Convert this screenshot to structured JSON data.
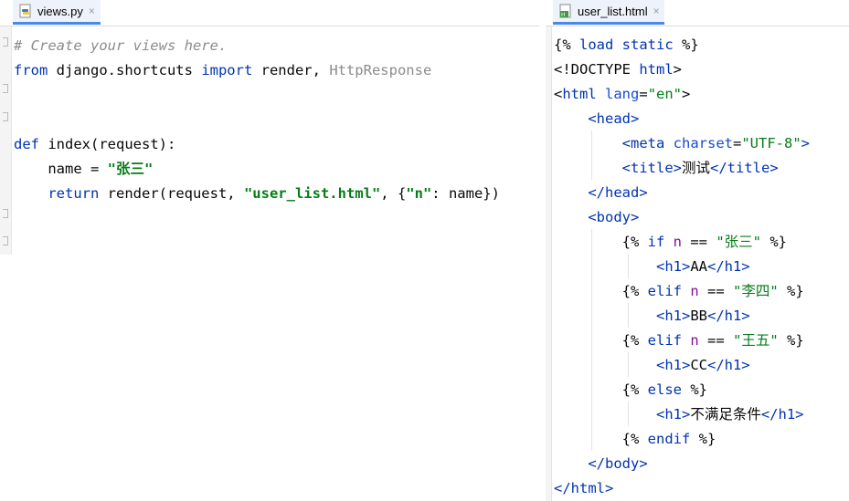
{
  "tabs": {
    "left": {
      "label": "views.py",
      "close": "×"
    },
    "right": {
      "label": "user_list.html",
      "close": "×"
    }
  },
  "icons": {
    "python_file": "python-file-icon",
    "html_file": "html-file-icon",
    "close": "close-icon"
  },
  "left_code": {
    "comment": "# Create your views here.",
    "from_kw": "from",
    "module": " django.shortcuts ",
    "import_kw": "import",
    "imported": " render, ",
    "unused_import": "HttpResponse",
    "def_kw": "def",
    "def_sig": " index(request):",
    "assign_name": "    name = ",
    "assign_value": "\"张三\"",
    "return_kw": "    return",
    "return_call": " render(request, ",
    "template_str": "\"user_list.html\"",
    "ctx_open": ", {",
    "ctx_key": "\"n\"",
    "ctx_rest": ": name})"
  },
  "right_code": {
    "line1_a": "{% ",
    "line1_kw": "load static",
    "line1_b": " %}",
    "line2_a": "<!DOCTYPE ",
    "line2_b": "html",
    "line2_c": ">",
    "line3_a": "<",
    "line3_tag": "html ",
    "line3_attr": "lang",
    "line3_eq": "=",
    "line3_val": "\"en\"",
    "line3_end": ">",
    "head_open": "    <head>",
    "meta_a": "        <",
    "meta_tag": "meta ",
    "meta_attr": "charset",
    "meta_eq": "=",
    "meta_val": "\"UTF-8\"",
    "meta_end": ">",
    "title_open": "        <title>",
    "title_text": "测试",
    "title_close": "</title>",
    "head_close": "    </head>",
    "body_open": "    <body>",
    "if_a": "        {% ",
    "if_kw": "if",
    "if_var": " n",
    "if_op": " == ",
    "if_val": "\"张三\"",
    "if_end": " %}",
    "h1_aa_open": "            <h1>",
    "h1_aa_text": "AA",
    "h1_aa_close": "</h1>",
    "elif1_kw": "elif",
    "elif1_val": "\"李四\"",
    "h1_bb_text": "BB",
    "elif2_val": "\"王五\"",
    "h1_cc_text": "CC",
    "else_kw": "else",
    "h1_else_text": "不满足条件",
    "endif_kw": "endif",
    "body_close": "    </body>",
    "html_close": "</html>"
  },
  "colors": {
    "keyword": "#0033b3",
    "string": "#067d17",
    "comment": "#8c8c8c",
    "tab_underline": "#4a88e8"
  }
}
